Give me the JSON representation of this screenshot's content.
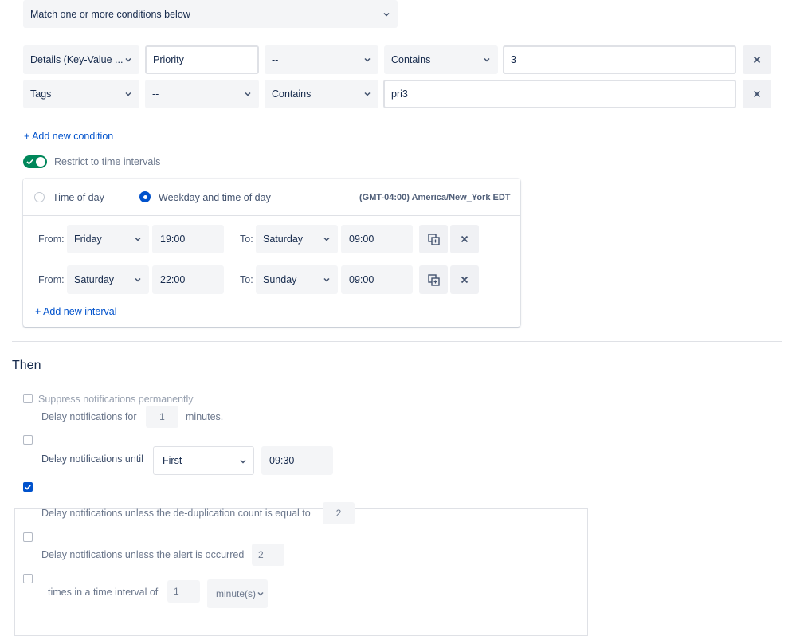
{
  "match_select": {
    "value": "Match one or more conditions below"
  },
  "conditions": [
    {
      "field": "Details (Key-Value ...",
      "key": "Priority",
      "not": "--",
      "operator": "Contains",
      "value": "3"
    },
    {
      "field": "Tags",
      "not": "--",
      "operator": "Contains",
      "value": "pri3"
    }
  ],
  "add_condition_label": "+ Add new condition",
  "restrict_toggle": {
    "label": "Restrict to time intervals",
    "on": true
  },
  "time_panel": {
    "option_time_of_day": "Time of day",
    "option_weekday": "Weekday and time of day",
    "timezone": "(GMT-04:00) America/New_York EDT",
    "from_label": "From:",
    "to_label": "To:",
    "intervals": [
      {
        "from_day": "Friday",
        "from_time": "19:00",
        "to_day": "Saturday",
        "to_time": "09:00"
      },
      {
        "from_day": "Saturday",
        "from_time": "22:00",
        "to_day": "Sunday",
        "to_time": "09:00"
      }
    ],
    "add_interval_label": "+ Add new interval"
  },
  "then_heading": "Then",
  "actions": {
    "suppress_label": "Suppress notifications permanently",
    "delay_for_label": "Delay notifications for",
    "delay_for_value": "1",
    "delay_for_unit": "minutes.",
    "delay_until_label": "Delay notifications until",
    "delay_until_select": "First",
    "delay_until_time": "09:30",
    "dedup_label": "Delay notifications unless the de-duplication count is equal to",
    "dedup_value": "2",
    "occurred_label": "Delay notifications unless the alert is occurred",
    "occurred_value": "2",
    "interval_label": "times in a time interval of",
    "interval_value": "1",
    "interval_unit": "minute(s)"
  },
  "colors": {
    "accent": "#0052cc",
    "toggle_on": "#00875a"
  }
}
